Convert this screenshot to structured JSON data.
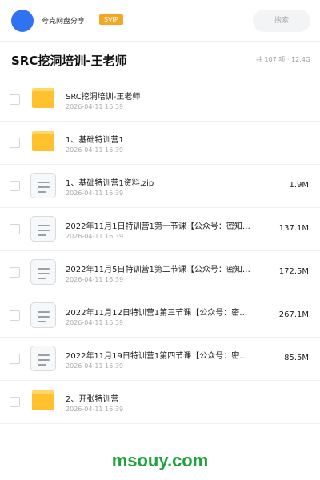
{
  "topbar": {
    "share_name": "夸克网盘分享",
    "badge": "SVIP",
    "search_placeholder": "搜索"
  },
  "folder": {
    "title": "SRC挖洞培训-王老师",
    "meta": "共 107 项 · 12.4G"
  },
  "items": [
    {
      "type": "folder",
      "name": "SRC挖洞培训-王老师",
      "date": "2026-04-11 16:39",
      "size": ""
    },
    {
      "type": "folder",
      "name": "1、基础特训营1",
      "date": "2026-04-11 16:39",
      "size": ""
    },
    {
      "type": "file",
      "name": "1、基础特训营1资料.zip",
      "date": "2026-04-11 16:39",
      "size": "1.9M"
    },
    {
      "type": "file",
      "name": "2022年11月1日特训营1第一节课【公众号：密知…",
      "date": "2026-04-11 16:39",
      "size": "137.1M"
    },
    {
      "type": "file",
      "name": "2022年11月5日特训营1第二节课【公众号：密知…",
      "date": "2026-04-11 16:39",
      "size": "172.5M"
    },
    {
      "type": "file",
      "name": "2022年11月12日特训营1第三节课【公众号：密…",
      "date": "2026-04-11 16:39",
      "size": "267.1M"
    },
    {
      "type": "file",
      "name": "2022年11月19日特训营1第四节课【公众号：密…",
      "date": "2026-04-11 16:39",
      "size": "85.5M"
    },
    {
      "type": "folder",
      "name": "2、开张特训营",
      "date": "2026-04-11 16:39",
      "size": ""
    }
  ],
  "watermark": "msouy.com",
  "colors": {
    "avatar": "#2f73f0",
    "badge": "#f5a623",
    "folder": "#ffc12e",
    "watermark": "#1fa341"
  }
}
